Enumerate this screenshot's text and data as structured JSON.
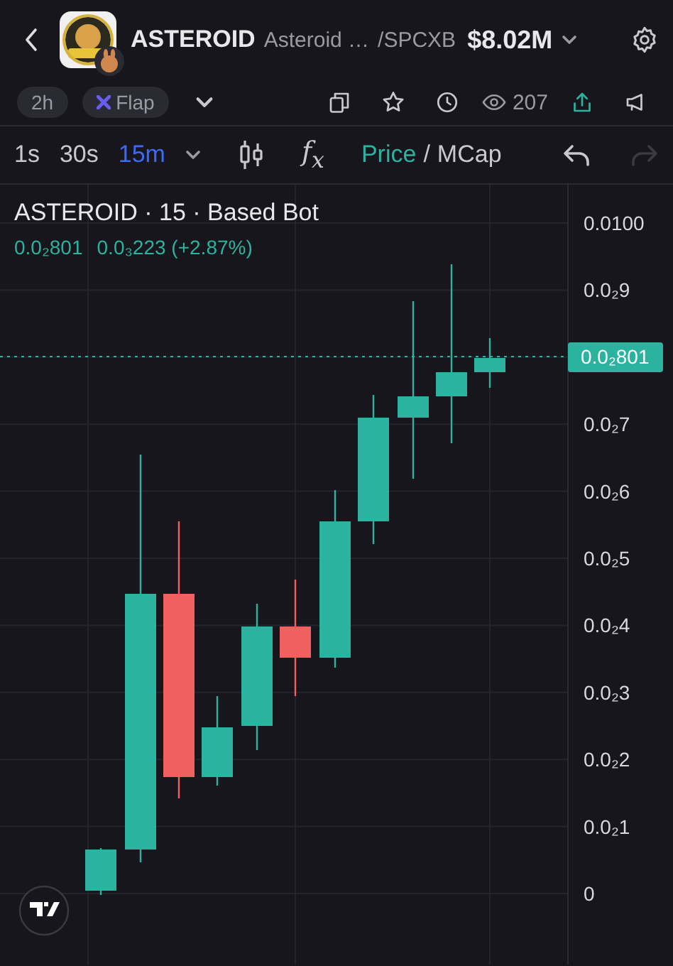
{
  "header": {
    "symbol": "ASTEROID",
    "name": "Asteroid …",
    "pair": "/SPCXB",
    "market_cap": "$8.02M"
  },
  "chips": [
    {
      "kind": "age",
      "label": "2h"
    },
    {
      "kind": "platform",
      "label": "Flap"
    }
  ],
  "stats": {
    "views": "207"
  },
  "toolbar": {
    "intervals": [
      {
        "label": "1s",
        "selected": false
      },
      {
        "label": "30s",
        "selected": false
      },
      {
        "label": "15m",
        "selected": true
      }
    ],
    "indicators": "f$_{x}$",
    "modes": [
      {
        "label": "Price",
        "selected": true
      },
      {
        "label": "MCap",
        "selected": false
      }
    ],
    "mode_separator": "/",
    "undo": {
      "disabled": false
    },
    "redo": {
      "disabled": true
    }
  },
  "chart": {
    "title": "ASTEROID · 15 · Based Bot",
    "price": "0.0₂801",
    "change": "0.0₃223 (+2.87%)",
    "y_ticks": [
      "0.0100",
      "0.0₂9",
      "0.0₂7",
      "0.0₂6",
      "0.0₂5",
      "0.0₂4",
      "0.0₂3",
      "0.0₂2",
      "0.0₂1",
      "0"
    ],
    "price_label": "0.0₂801"
  }
}
